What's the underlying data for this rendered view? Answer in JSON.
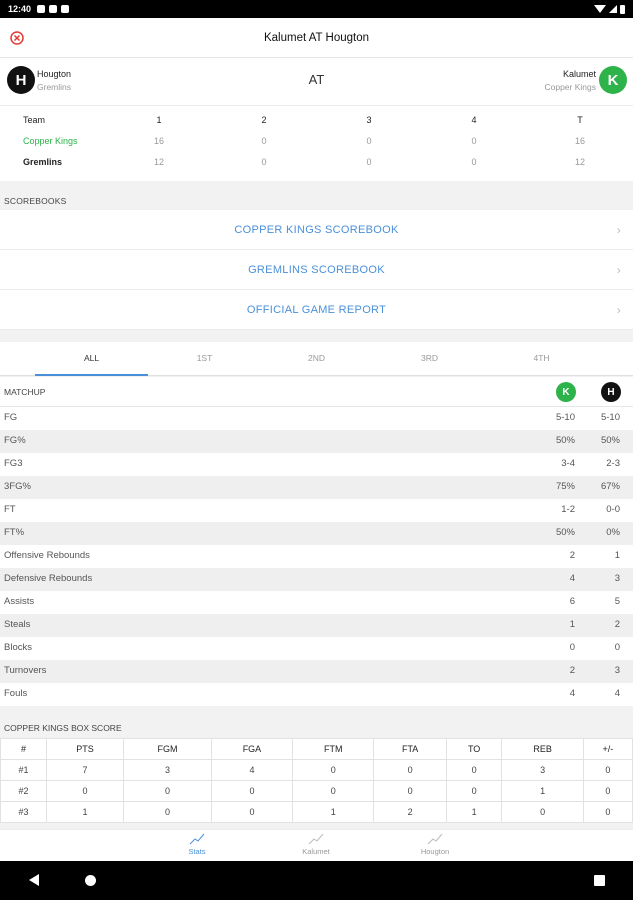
{
  "status_bar": {
    "time": "12:40"
  },
  "header": {
    "title": "Kalumet AT Hougton"
  },
  "matchup_header": {
    "home": {
      "initial": "H",
      "name": "Hougton",
      "nickname": "Gremlins"
    },
    "away": {
      "initial": "K",
      "name": "Kalumet",
      "nickname": "Copper Kings"
    },
    "separator": "AT"
  },
  "line_score": {
    "headers": [
      "Team",
      "1",
      "2",
      "3",
      "4",
      "T"
    ],
    "rows": [
      {
        "team": "Copper Kings",
        "values": [
          "16",
          "0",
          "0",
          "0",
          "16"
        ]
      },
      {
        "team": "Gremlins",
        "values": [
          "12",
          "0",
          "0",
          "0",
          "12"
        ]
      }
    ]
  },
  "scorebooks": {
    "label": "SCOREBOOKS",
    "items": [
      "COPPER KINGS SCOREBOOK",
      "GREMLINS SCOREBOOK",
      "OFFICIAL GAME REPORT"
    ]
  },
  "period_tabs": [
    "ALL",
    "1ST",
    "2ND",
    "3RD",
    "4TH"
  ],
  "matchup": {
    "label": "MATCHUP",
    "left_initial": "K",
    "right_initial": "H",
    "stats": [
      {
        "name": "FG",
        "k": "5-10",
        "h": "5-10"
      },
      {
        "name": "FG%",
        "k": "50%",
        "h": "50%"
      },
      {
        "name": "FG3",
        "k": "3-4",
        "h": "2-3"
      },
      {
        "name": "3FG%",
        "k": "75%",
        "h": "67%"
      },
      {
        "name": "FT",
        "k": "1-2",
        "h": "0-0"
      },
      {
        "name": "FT%",
        "k": "50%",
        "h": "0%"
      },
      {
        "name": "Offensive Rebounds",
        "k": "2",
        "h": "1"
      },
      {
        "name": "Defensive Rebounds",
        "k": "4",
        "h": "3"
      },
      {
        "name": "Assists",
        "k": "6",
        "h": "5"
      },
      {
        "name": "Steals",
        "k": "1",
        "h": "2"
      },
      {
        "name": "Blocks",
        "k": "0",
        "h": "0"
      },
      {
        "name": "Turnovers",
        "k": "2",
        "h": "3"
      },
      {
        "name": "Fouls",
        "k": "4",
        "h": "4"
      }
    ]
  },
  "box_score": {
    "label": "COPPER KINGS BOX SCORE",
    "headers": [
      "#",
      "PTS",
      "FGM",
      "FGA",
      "FTM",
      "FTA",
      "TO",
      "REB",
      "+/-"
    ],
    "rows": [
      [
        "#1",
        "7",
        "3",
        "4",
        "0",
        "0",
        "0",
        "3",
        "0"
      ],
      [
        "#2",
        "0",
        "0",
        "0",
        "0",
        "0",
        "0",
        "1",
        "0"
      ],
      [
        "#3",
        "1",
        "0",
        "0",
        "1",
        "2",
        "1",
        "0",
        "0"
      ]
    ]
  },
  "bottom_nav": [
    "Stats",
    "Kalumet",
    "Hougton"
  ],
  "colors": {
    "accent": "#4a90d9",
    "copper_kings": "#2db34a",
    "gremlins": "#111111",
    "close": "#e53935"
  }
}
